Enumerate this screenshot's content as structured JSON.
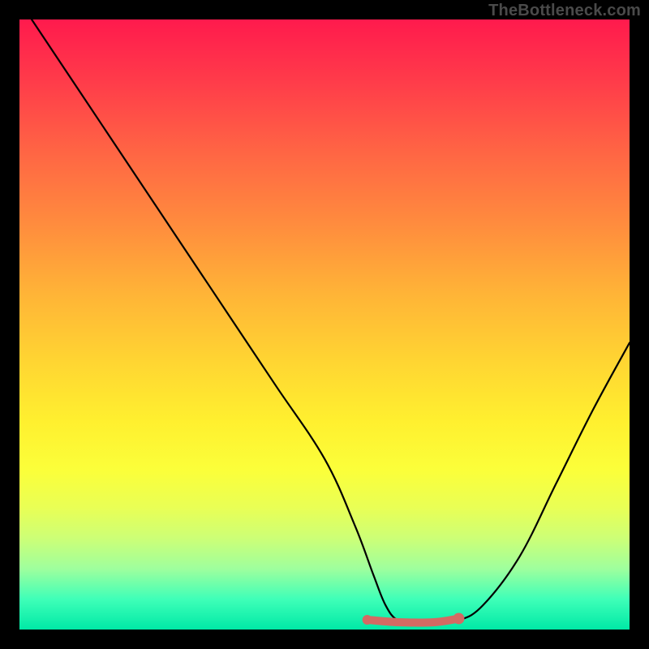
{
  "watermark": "TheBottleneck.com",
  "chart_data": {
    "type": "line",
    "title": "",
    "xlabel": "",
    "ylabel": "",
    "xlim": [
      0,
      100
    ],
    "ylim": [
      0,
      100
    ],
    "series": [
      {
        "name": "curve",
        "color": "#000000",
        "x": [
          2,
          10,
          18,
          26,
          34,
          42,
          50,
          55,
          58,
          60,
          62,
          65,
          68,
          72,
          76,
          82,
          88,
          94,
          100
        ],
        "y": [
          100,
          88,
          76,
          64,
          52,
          40,
          28,
          17,
          9,
          4,
          1.5,
          1,
          1,
          1.5,
          4,
          12,
          24,
          36,
          47
        ]
      },
      {
        "name": "valley-marker",
        "color": "#d46a63",
        "x": [
          57,
          62,
          68,
          72
        ],
        "y": [
          1.6,
          1.2,
          1.2,
          1.8
        ]
      }
    ]
  }
}
